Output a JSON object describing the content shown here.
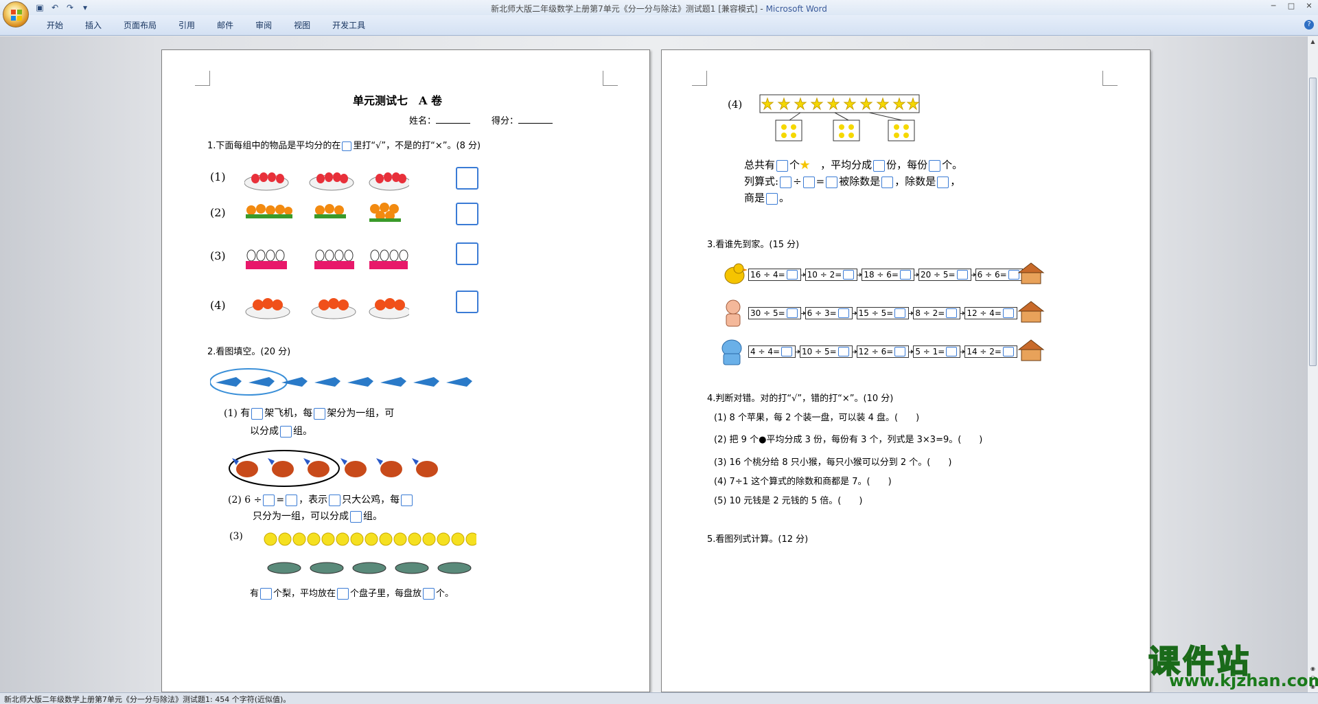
{
  "window": {
    "title": "新北师大版二年级数学上册第7单元《分一分与除法》测试题1 [兼容模式] - ",
    "app": "Microsoft Word"
  },
  "ribbon": {
    "tabs": [
      "开始",
      "插入",
      "页面布局",
      "引用",
      "邮件",
      "审阅",
      "视图",
      "开发工具"
    ]
  },
  "status": {
    "text": "新北师大版二年级数学上册第7单元《分一分与除法》测试题1: 454 个字符(近似值)。"
  },
  "page1": {
    "title": "单元测试七　A 卷",
    "name_label": "姓名：",
    "score_label": "得分：",
    "q1": {
      "pre": "1.下面每组中的物品是平均分的在",
      "post": "里打“√”，不是的打“×”。(8 分)"
    },
    "q1_labels": [
      "(1)",
      "(2)",
      "(3)",
      "(4)"
    ],
    "q2": "2.看图填空。(20 分)",
    "q2_1": {
      "a": "(1) 有",
      "b": "架飞机，每",
      "c": "架分为一组，可",
      "d": "以分成",
      "e": "组。"
    },
    "q2_2": {
      "a": "(2) 6 ÷",
      "b": "=",
      "c": "，表示",
      "d": "只大公鸡，每",
      "e": "只分为一组，可以分成",
      "f": "组。"
    },
    "q2_3": {
      "label": "(3)",
      "a": "有",
      "b": "个梨，平均放在",
      "c": "个盘子里，每盘放",
      "d": "个。"
    }
  },
  "page2": {
    "q2_4": {
      "label": "(4)",
      "a": "总共有",
      "b": "个",
      "c": "，平均分成",
      "d": "份，每份",
      "e": "个。",
      "f": "列算式:",
      "g": "÷",
      "h": "=",
      "i": "被除数是",
      "j": "，除数是",
      "k": "，",
      "l": "商是",
      "m": "。"
    },
    "q3": "3.看谁先到家。(15 分)",
    "q3_rows": [
      [
        "16 ÷ 4=",
        "10 ÷ 2=",
        "18 ÷ 6=",
        "20 ÷ 5=",
        "6 ÷ 6="
      ],
      [
        "30 ÷ 5=",
        "6 ÷ 3=",
        "15 ÷ 5=",
        "8 ÷ 2=",
        "12 ÷ 4="
      ],
      [
        "4 ÷ 4=",
        "10 ÷ 5=",
        "12 ÷ 6=",
        "5 ÷ 1=",
        "14 ÷ 2="
      ]
    ],
    "q4": "4.判断对错。对的打“√”，错的打“×”。(10 分)",
    "q4_items": [
      "(1) 8 个苹果，每 2 个装一盘，可以装 4 盘。(　　)",
      "(2) 把 9 个",
      "平均分成 3 份，每份有 3 个，列式是 3×3=9。(　　)",
      "(3) 16 个桃分给 8 只小猴，每只小猴可以分到 2 个。(　　)",
      "(4) 7÷1 这个算式的除数和商都是 7。(　　)",
      "(5) 10 元钱是 2 元钱的 5 倍。(　　)"
    ],
    "q5": "5.看图列式计算。(12 分)"
  },
  "watermark": {
    "cn": "课件站",
    "url": "www.kjzhan.com"
  },
  "pm": "↵"
}
